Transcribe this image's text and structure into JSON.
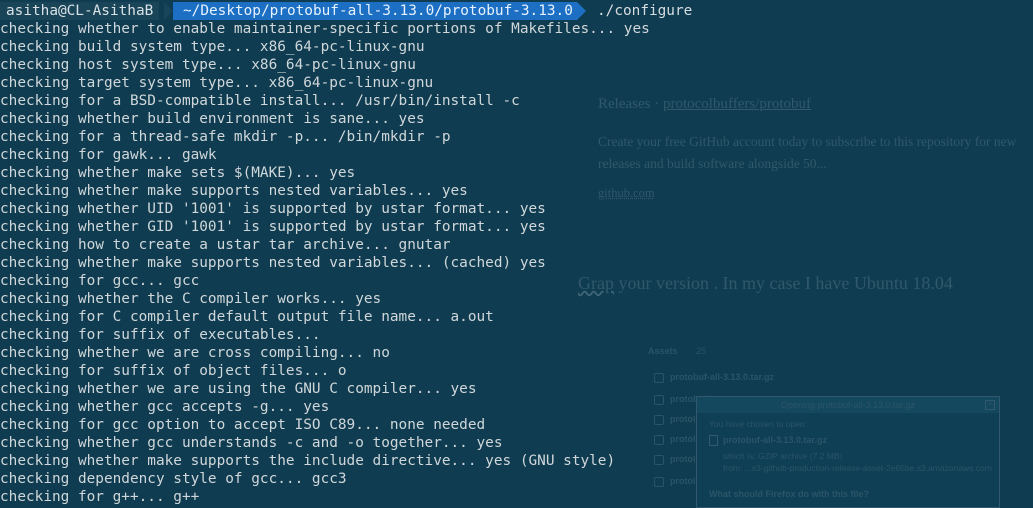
{
  "prompt": {
    "user": "asitha@CL-AsithaB",
    "path": "~/Desktop/protobuf-all-3.13.0/protobuf-3.13.0",
    "command": "./configure"
  },
  "output_lines": [
    "checking whether to enable maintainer-specific portions of Makefiles... yes",
    "checking build system type... x86_64-pc-linux-gnu",
    "checking host system type... x86_64-pc-linux-gnu",
    "checking target system type... x86_64-pc-linux-gnu",
    "checking for a BSD-compatible install... /usr/bin/install -c",
    "checking whether build environment is sane... yes",
    "checking for a thread-safe mkdir -p... /bin/mkdir -p",
    "checking for gawk... gawk",
    "checking whether make sets $(MAKE)... yes",
    "checking whether make supports nested variables... yes",
    "checking whether UID '1001' is supported by ustar format... yes",
    "checking whether GID '1001' is supported by ustar format... yes",
    "checking how to create a ustar tar archive... gnutar",
    "checking whether make supports nested variables... (cached) yes",
    "checking for gcc... gcc",
    "checking whether the C compiler works... yes",
    "checking for C compiler default output file name... a.out",
    "checking for suffix of executables...",
    "checking whether we are cross compiling... no",
    "checking for suffix of object files... o",
    "checking whether we are using the GNU C compiler... yes",
    "checking whether gcc accepts -g... yes",
    "checking for gcc option to accept ISO C89... none needed",
    "checking whether gcc understands -c and -o together... yes",
    "checking whether make supports the include directive... yes (GNU style)",
    "checking dependency style of gcc... gcc3",
    "checking for g++... g++"
  ],
  "background_page": {
    "releases_prefix": "Releases · ",
    "releases_link": "protocolbuffers/protobuf",
    "description": "Create your free GitHub account today to subscribe to this repository for new releases and build software alongside 50...",
    "site": "github.com",
    "grap_word": "Grap",
    "grap_rest": " your version . In my case I have Ubuntu 18.04",
    "assets_label": "Assets",
    "assets_count": "25",
    "asset_1": "protobuf-all-3.13.0.tar.gz",
    "asset_partial": "protobuf",
    "asset_partial_short": "protol",
    "dialog_title": "Opening protobuf-all-3.13.0.tar.gz",
    "dialog_prompt": "You have chosen to open:",
    "dialog_file": "protobuf-all-3.13.0.tar.gz",
    "dialog_type": "which is: GZIP archive (7.2 MB)",
    "dialog_from": "from: ...s3-github-production-release-asset-2e65be.s3.amazonaws.com",
    "dialog_bottom": "What should Firefox do with this file?"
  }
}
